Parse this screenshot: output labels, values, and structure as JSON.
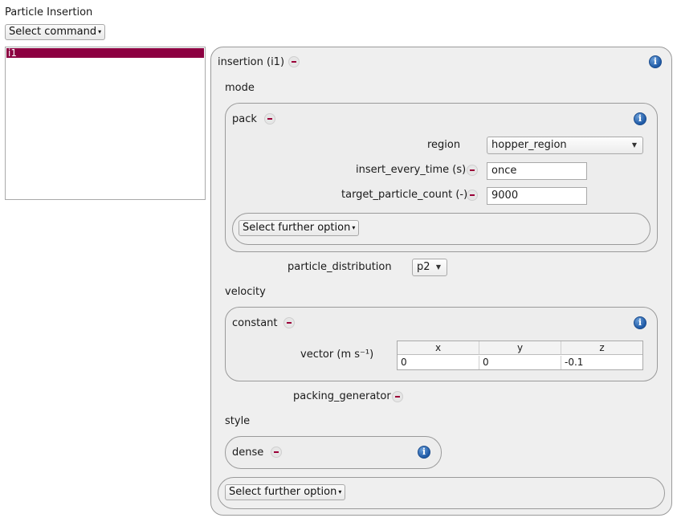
{
  "page_title": "Particle Insertion",
  "command_select": {
    "label": "Select command"
  },
  "command_list": {
    "items": [
      "i1"
    ]
  },
  "insertion": {
    "title": "insertion (i1)",
    "mode_label": "mode",
    "pack": {
      "title": "pack",
      "region_label": "region",
      "region_value": "hopper_region",
      "insert_every_time_label": "insert_every_time (s)",
      "insert_every_time_value": "once",
      "target_particle_count_label": "target_particle_count (-)",
      "target_particle_count_value": "9000",
      "further_option_label": "Select further option"
    },
    "particle_distribution_label": "particle_distribution",
    "particle_distribution_value": "p2",
    "velocity_label": "velocity",
    "constant": {
      "title": "constant",
      "vector_label": "vector (m s⁻¹)",
      "columns": [
        "x",
        "y",
        "z"
      ],
      "values": [
        "0",
        "0",
        "-0.1"
      ]
    },
    "packing_generator_label": "packing_generator",
    "style_label": "style",
    "dense": {
      "title": "dense"
    },
    "further_option_label": "Select further option"
  },
  "icons": {
    "minus": "remove-minus-icon",
    "info": "info-icon",
    "dropdown": "chevron-down-icon"
  },
  "colors": {
    "selection": "#8c0041",
    "minus": "#9b0038",
    "info": "#1f5aa6"
  }
}
